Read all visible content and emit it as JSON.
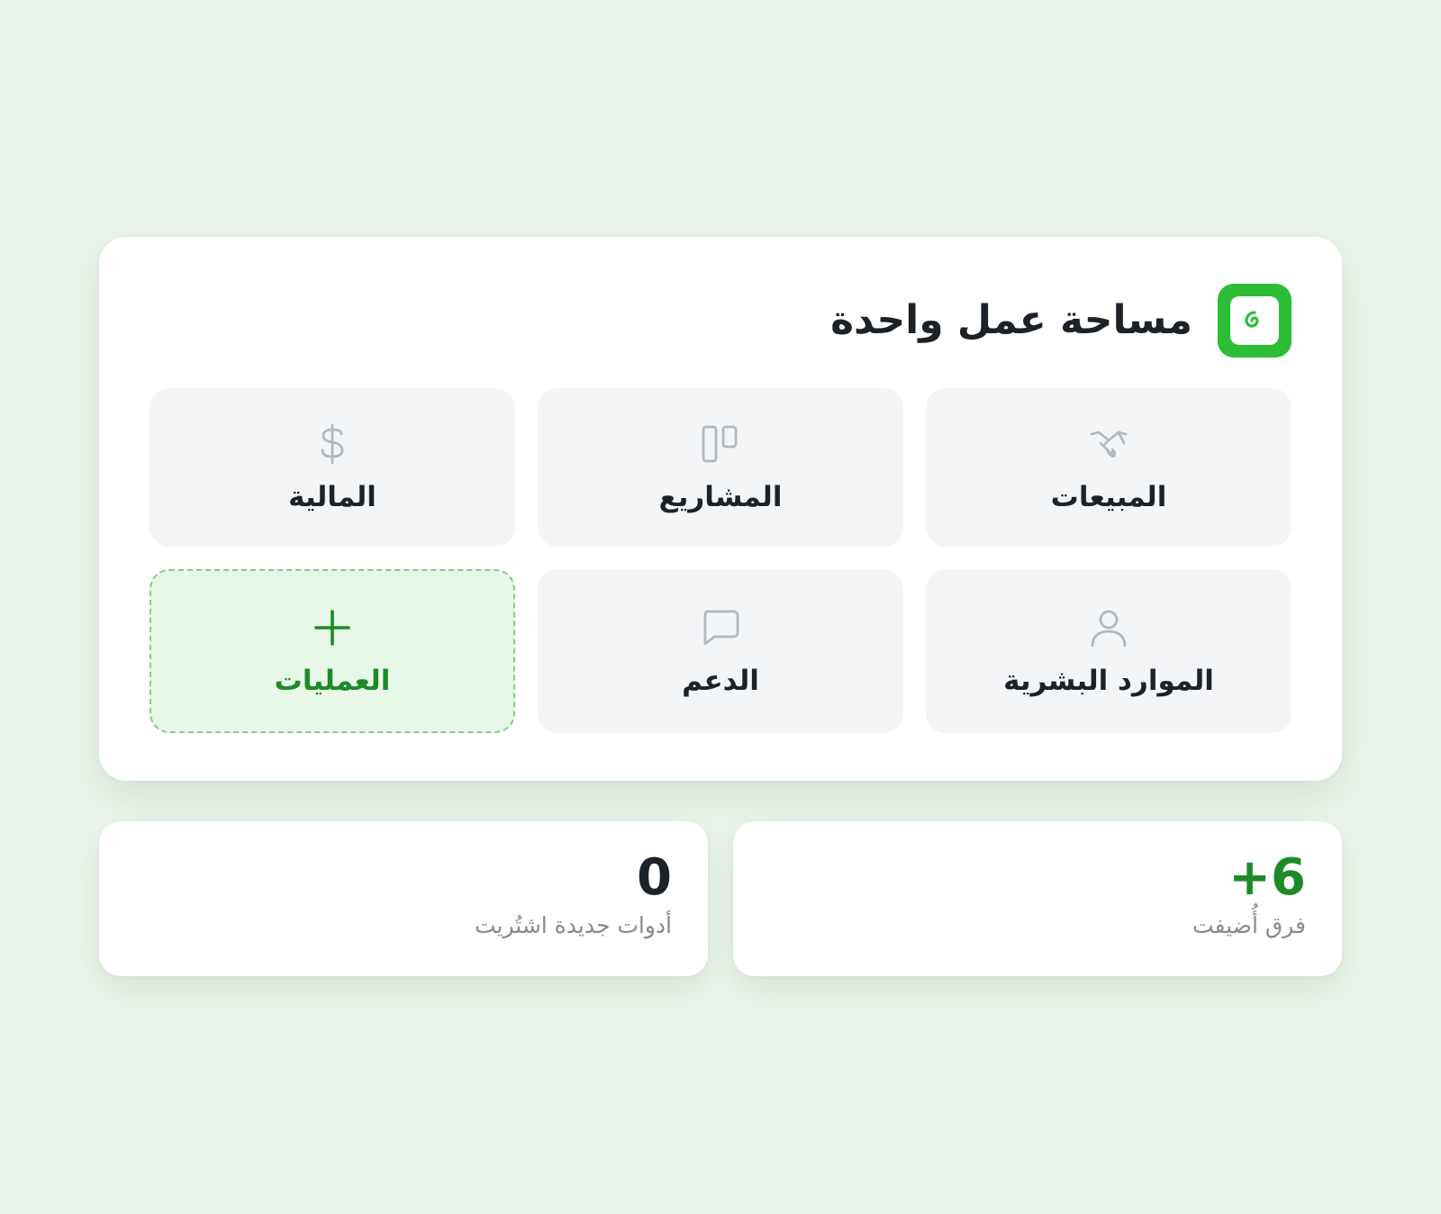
{
  "header": {
    "title": "مساحة عمل واحدة",
    "logo_icon": "swirl-logo-icon"
  },
  "tiles": [
    {
      "label": "المبيعات",
      "icon": "handshake-icon",
      "state": "normal"
    },
    {
      "label": "المشاريع",
      "icon": "kanban-board-icon",
      "state": "normal"
    },
    {
      "label": "المالية",
      "icon": "dollar-icon",
      "state": "normal"
    },
    {
      "label": "الموارد البشرية",
      "icon": "user-icon",
      "state": "normal"
    },
    {
      "label": "الدعم",
      "icon": "chat-bubble-icon",
      "state": "normal"
    },
    {
      "label": "العمليات",
      "icon": "plus-icon",
      "state": "active"
    }
  ],
  "stats": [
    {
      "value": "+6",
      "label": "فرق أُضيفت"
    },
    {
      "value": "0",
      "label": "أدوات جديدة اشتُريت"
    }
  ],
  "colors": {
    "background": "#e9f3e9",
    "accent": "#2bbd36",
    "accent_dark": "#1d8a27",
    "icon_muted": "#b3b8bd",
    "text": "#1d2228",
    "muted_text": "#858b91"
  }
}
